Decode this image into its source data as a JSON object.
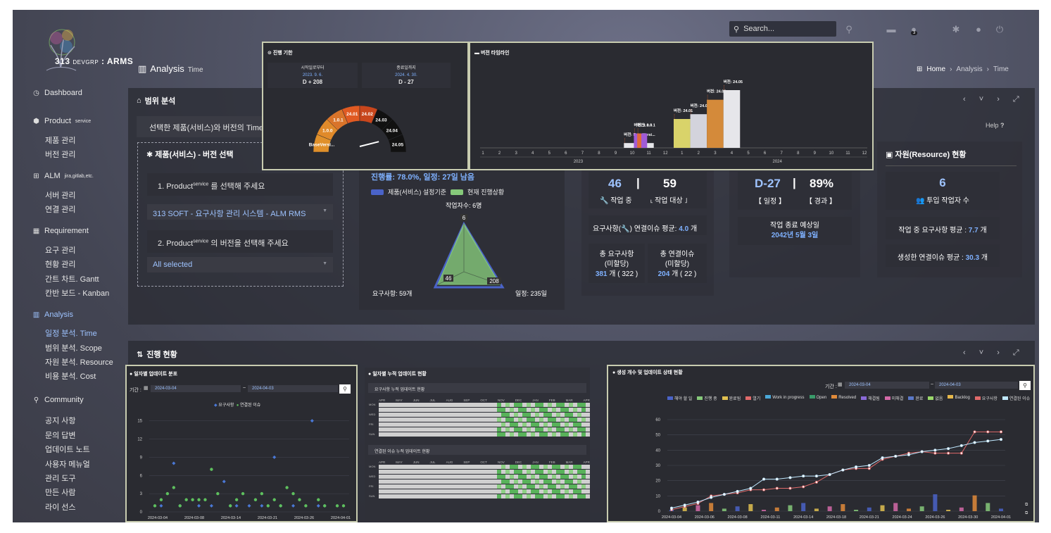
{
  "app": {
    "logo_number": "313",
    "logo_team": "DEVGRP",
    "logo_name": "ARMS"
  },
  "search": {
    "placeholder": "Search..."
  },
  "notification_count": "3",
  "page": {
    "title": "Analysis",
    "subtitle": "Time"
  },
  "breadcrumb": [
    "Home",
    "Analysis",
    "Time"
  ],
  "sidebar": {
    "dashboard": "Dashboard",
    "product": {
      "label": "Product",
      "sup": "service",
      "items": [
        "제품 관리",
        "버전 관리"
      ]
    },
    "alm": {
      "label": "ALM",
      "sup": "jira,gitlab,etc.",
      "items": [
        "서버 관리",
        "연결 관리"
      ]
    },
    "requirement": {
      "label": "Requirement",
      "items": [
        "요구 관리",
        "현황 관리",
        "간트 차트. Gantt",
        "칸반 보드 - Kanban"
      ]
    },
    "analysis": {
      "label": "Analysis",
      "items": [
        "일정 분석. Time",
        "범위 분석. Scope",
        "자원 분석. Resource",
        "비용 분석. Cost"
      ]
    },
    "community": {
      "label": "Community",
      "items": [
        "공지 사항",
        "문의 답변",
        "업데이트 노트",
        "사용자 메뉴얼",
        "관리 도구",
        "만든 사람",
        "라이 선스"
      ]
    }
  },
  "scope_panel": {
    "title": "범위 분석",
    "description": "선택한 제품(서비스)와 버전의 Time 관",
    "help": "Help"
  },
  "selector": {
    "title": "제품(서비스) - 버전 선택",
    "step1_a": "1. Product",
    "step1_sup": "service",
    "step1_b": "를 선택해 주세요",
    "product_value": "313 SOFT - 요구사항 관리 시스템 - ALM RMS",
    "step2_a": "2. Product",
    "step2_sup": "service",
    "step2_b": "의 버전을 선택해 주세요",
    "version_value": "All selected"
  },
  "radar": {
    "progress_text": "진행률: 78.0%, 일정: 27일 남음",
    "legend_a": "제품(서비스) 설정기준",
    "legend_b": "현재 진행상황",
    "workers_label": "작업자수: 6명",
    "top_value": "6",
    "left_value": "46",
    "right_value": "208",
    "left_label": "요구사항: 59개",
    "right_label": "일정: 235일"
  },
  "counts": {
    "in_progress_num": "46",
    "in_progress_label": "작업 중",
    "target_num": "59",
    "target_label": "작업 대상",
    "link_avg_a": "요구사항(",
    "link_avg_b": ") 연결이슈 평균:",
    "link_avg_value": "4.0",
    "link_avg_unit": "개",
    "total_req_label": "총 요구사항",
    "total_req_sub": "(미할당)",
    "total_req_value": "381",
    "total_req_unassigned": "322",
    "total_link_label": "총 연결이슈",
    "total_link_sub": "(미할당)",
    "total_link_value": "204",
    "total_link_unassigned": "22",
    "unit": "개"
  },
  "schedule": {
    "dday": "D-27",
    "dday_label": "【 일정 】",
    "percent": "89%",
    "percent_label": "【 경과 】",
    "end_label": "작업 종료 예상일",
    "end_value": "2042년 5월 3일"
  },
  "resource": {
    "title": "자원(Resource) 현황",
    "workers_num": "6",
    "workers_label": "투입 작업자 수",
    "avg_req_label": "작업 중 요구사항 평균 :",
    "avg_req_value": "7.7",
    "avg_link_label": "생성한 연결이슈 평균 :",
    "avg_link_value": "30.3",
    "unit": "개"
  },
  "progress_panel": {
    "title": "진행 현황"
  },
  "popup_period": {
    "title": "진행 기한",
    "start_label": "시작일로부터",
    "start_date": "2023. 9. 6.",
    "start_value": "D + 208",
    "end_label": "종료일까지",
    "end_date": "2024. 4. 30.",
    "end_value": "D - 27",
    "gauge_labels": [
      "BaseVersi...",
      "1.0.0",
      "1.0.1",
      "24.01",
      "24.02",
      "24.03",
      "24.04",
      "24.05"
    ]
  },
  "popup_timeline": {
    "title": "버전 타임라인",
    "months": [
      "1",
      "2",
      "3",
      "4",
      "5",
      "6",
      "7",
      "8",
      "9",
      "10",
      "11",
      "12",
      "1",
      "2",
      "3",
      "4",
      "5",
      "6",
      "7",
      "8",
      "9",
      "10",
      "11",
      "12"
    ],
    "years": [
      "2023",
      "2024"
    ],
    "bar_labels": [
      "버전: BaseVersi...",
      "버전: 1.0.0",
      "버전: 1.0.1",
      "버전: 24.01",
      "버전: 24.02",
      "버전: 24.03",
      "버전: 24.05"
    ]
  },
  "daily_panel": {
    "title": "일자별 업데이트 분포",
    "period_label": "기간 :",
    "from": "2024-03-04",
    "to": "2024-04-03",
    "legend_a": "요구사항",
    "legend_b": "연결된 이슈"
  },
  "heat_panel": {
    "title": "일자별 누적 업데이트 현황",
    "sub_a": "요구사항 누적 업데이트 현황",
    "sub_b": "연결된 이슈 누적 업데이트 현황",
    "months": [
      "APR",
      "MAY",
      "JUN",
      "JUL",
      "AUG",
      "SEP",
      "OCT",
      "NOV",
      "DEC",
      "JAN",
      "FEB",
      "MAR",
      "APR"
    ],
    "days": [
      "MON",
      "WED",
      "FRI",
      "SUN"
    ]
  },
  "state_panel": {
    "title": "생성 개수 및 업데이트 상태 현황",
    "period_label": "기간 :",
    "from": "2024-03-04",
    "to": "2024-04-03",
    "legend": [
      "해야 할 일",
      "진행 중",
      "완료됨",
      "열기",
      "Work in progress",
      "Open",
      "Resolved",
      "해결됨",
      "미해결",
      "완료",
      "없음",
      "Backlog",
      "요구사항",
      "연결된 이슈"
    ]
  },
  "chart_data": [
    {
      "type": "scatter",
      "title": "일자별 업데이트 분포",
      "x_ticks": [
        "2024-03-04",
        "2024-03-08",
        "2024-03-14",
        "2024-03-21",
        "2024-03-26",
        "2024-04-01"
      ],
      "y_ticks": [
        0,
        3,
        6,
        9,
        12,
        15
      ],
      "ylim": [
        0,
        16
      ],
      "series": [
        {
          "name": "요구사항",
          "color": "#4a78d6",
          "points": [
            [
              1,
              1
            ],
            [
              3,
              8
            ],
            [
              4,
              1
            ],
            [
              7,
              1
            ],
            [
              9,
              1
            ],
            [
              11,
              5
            ],
            [
              12,
              1
            ],
            [
              13,
              1
            ],
            [
              15,
              1
            ],
            [
              17,
              1
            ],
            [
              19,
              9
            ],
            [
              20,
              1
            ],
            [
              22,
              1
            ],
            [
              25,
              15
            ],
            [
              26,
              1
            ],
            [
              27,
              1
            ]
          ]
        },
        {
          "name": "연결된 이슈",
          "color": "#5ec05e",
          "points": [
            [
              0,
              1
            ],
            [
              1,
              2
            ],
            [
              2,
              3
            ],
            [
              3,
              4
            ],
            [
              4,
              1
            ],
            [
              5,
              2
            ],
            [
              6,
              2
            ],
            [
              7,
              2
            ],
            [
              8,
              2
            ],
            [
              9,
              7
            ],
            [
              10,
              3
            ],
            [
              12,
              1
            ],
            [
              13,
              2
            ],
            [
              14,
              3
            ],
            [
              16,
              2
            ],
            [
              17,
              3
            ],
            [
              18,
              1
            ],
            [
              19,
              2
            ],
            [
              20,
              1
            ],
            [
              21,
              4
            ],
            [
              22,
              3
            ],
            [
              23,
              2
            ],
            [
              24,
              1
            ],
            [
              26,
              2
            ],
            [
              27,
              1
            ],
            [
              29,
              1
            ],
            [
              30,
              1
            ]
          ]
        }
      ]
    },
    {
      "type": "bar",
      "title": "버전 타임라인",
      "categories": [
        "버전: BaseVersi...",
        "버전: 1.0.0",
        "버전: 1.0.1",
        "버전: 24.01",
        "버전: 24.02",
        "버전: 24.03",
        "버전: 24.05"
      ],
      "values": [
        1,
        3,
        3,
        6,
        7,
        10,
        12
      ],
      "colors": [
        "#e6e6ea",
        "#a05bd6",
        "#e06a3a",
        "#d9d36a",
        "#d3d3dc",
        "#d48a3a",
        "#e6e6ea"
      ]
    },
    {
      "type": "line",
      "title": "생성 개수 및 업데이트 상태 현황",
      "x_ticks": [
        "2024-03-04",
        "2024-03-06",
        "2024-03-08",
        "2024-03-11",
        "2024-03-14",
        "2024-03-18",
        "2024-03-21",
        "2024-03-24",
        "2024-03-26",
        "2024-03-30",
        "2024-04-01"
      ],
      "y_ticks": [
        0,
        10,
        20,
        30,
        40,
        50,
        60
      ],
      "ylim": [
        0,
        60
      ],
      "series": [
        {
          "name": "요구사항",
          "color": "#e06a6a",
          "values": [
            1,
            3,
            5,
            10,
            11,
            12,
            14,
            14,
            15,
            15,
            16,
            19,
            24,
            27,
            28,
            28,
            34,
            36,
            38,
            39,
            38,
            38,
            38,
            52,
            52,
            52
          ]
        },
        {
          "name": "연결된 이슈",
          "color": "#bfe8ff",
          "values": [
            2,
            4,
            6,
            9,
            11,
            13,
            15,
            21,
            21,
            22,
            23,
            23,
            24,
            27,
            29,
            30,
            35,
            36,
            37,
            39,
            40,
            41,
            43,
            45,
            46,
            47
          ]
        }
      ]
    }
  ]
}
